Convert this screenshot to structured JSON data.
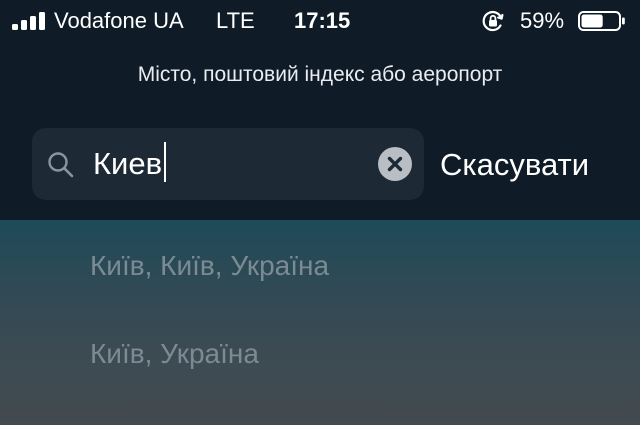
{
  "status_bar": {
    "carrier": "Vodafone UA",
    "network": "LTE",
    "time": "17:15",
    "battery_percent": "59%",
    "battery_level": 0.59,
    "icons": [
      "signal-bars-icon",
      "orientation-lock-icon",
      "battery-icon"
    ]
  },
  "search": {
    "prompt": "Місто, поштовий індекс або аеропорт",
    "value": "Киев",
    "cancel_label": "Скасувати",
    "icons": [
      "search-icon",
      "clear-icon"
    ]
  },
  "results": [
    {
      "label": "Київ, Київ, Україна"
    },
    {
      "label": "Київ, Україна"
    },
    {
      "label": ""
    }
  ],
  "colors": {
    "header_bg": "#0f1b26",
    "search_field_bg": "#1d2934",
    "result_text": "#7c8a93",
    "accent_text": "#ffffff"
  }
}
